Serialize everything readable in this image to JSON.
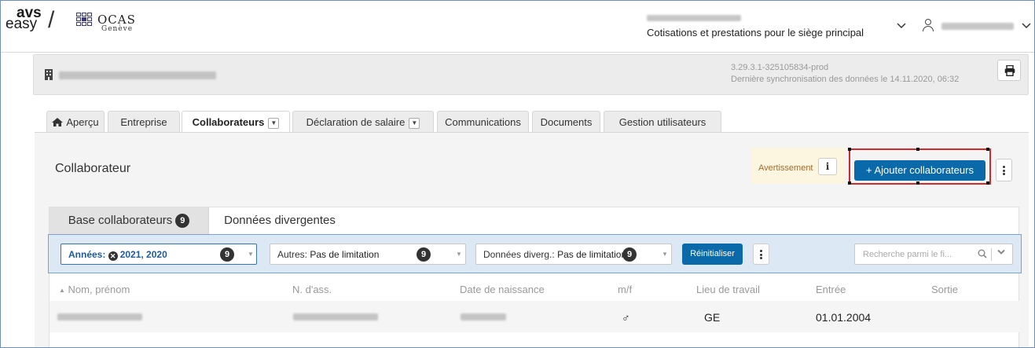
{
  "header": {
    "brand_avs": "avs",
    "brand_easy": "easy",
    "brand_slash": "/",
    "ocas_name": "OCAS",
    "ocas_sub": "Genève",
    "company_subtitle": "Cotisations et prestations pour le siège principal"
  },
  "company_band": {
    "version": "3.29.3.1-325105834-prod",
    "sync_text": "Dernière synchronisation des données le 14.11.2020, 06:32"
  },
  "tabs": [
    {
      "label": "Aperçu",
      "icon": "home-icon"
    },
    {
      "label": "Entreprise"
    },
    {
      "label": "Collaborateurs",
      "active": true,
      "dropdown": true
    },
    {
      "label": "Déclaration de salaire",
      "dropdown": true
    },
    {
      "label": "Communications"
    },
    {
      "label": "Documents"
    },
    {
      "label": "Gestion utilisateurs"
    }
  ],
  "main": {
    "title": "Collaborateur",
    "warning_label": "Avertissement",
    "warning_icon": "i",
    "add_button": "+ Ajouter collaborateurs"
  },
  "subtabs": {
    "base_label": "Base collaborateurs",
    "base_count": "9",
    "divergent_label": "Données divergentes"
  },
  "filters": {
    "years_label": "Années:",
    "years_value": "2021, 2020",
    "years_count": "9",
    "others_label": "Autres:",
    "others_value": "Pas de limitation",
    "others_count": "9",
    "divergent_label": "Données diverg.:",
    "divergent_value": "Pas de limitation",
    "divergent_count": "9",
    "reset_label": "Réinitialiser",
    "search_placeholder": "Recherche parmi le fi..."
  },
  "table": {
    "columns": [
      "Nom, prénom",
      "N. d'ass.",
      "Date de naissance",
      "m/f",
      "Lieu de travail",
      "Entrée",
      "Sortie"
    ],
    "rows": [
      {
        "gender": "♂",
        "workplace": "GE",
        "entry": "01.01.2004",
        "exit": ""
      }
    ]
  },
  "colors": {
    "primary_button": "#0a69a8",
    "highlight_frame": "#d02a2a",
    "filter_bar": "#dce9f5",
    "warning_bg": "#fcf6e0"
  }
}
